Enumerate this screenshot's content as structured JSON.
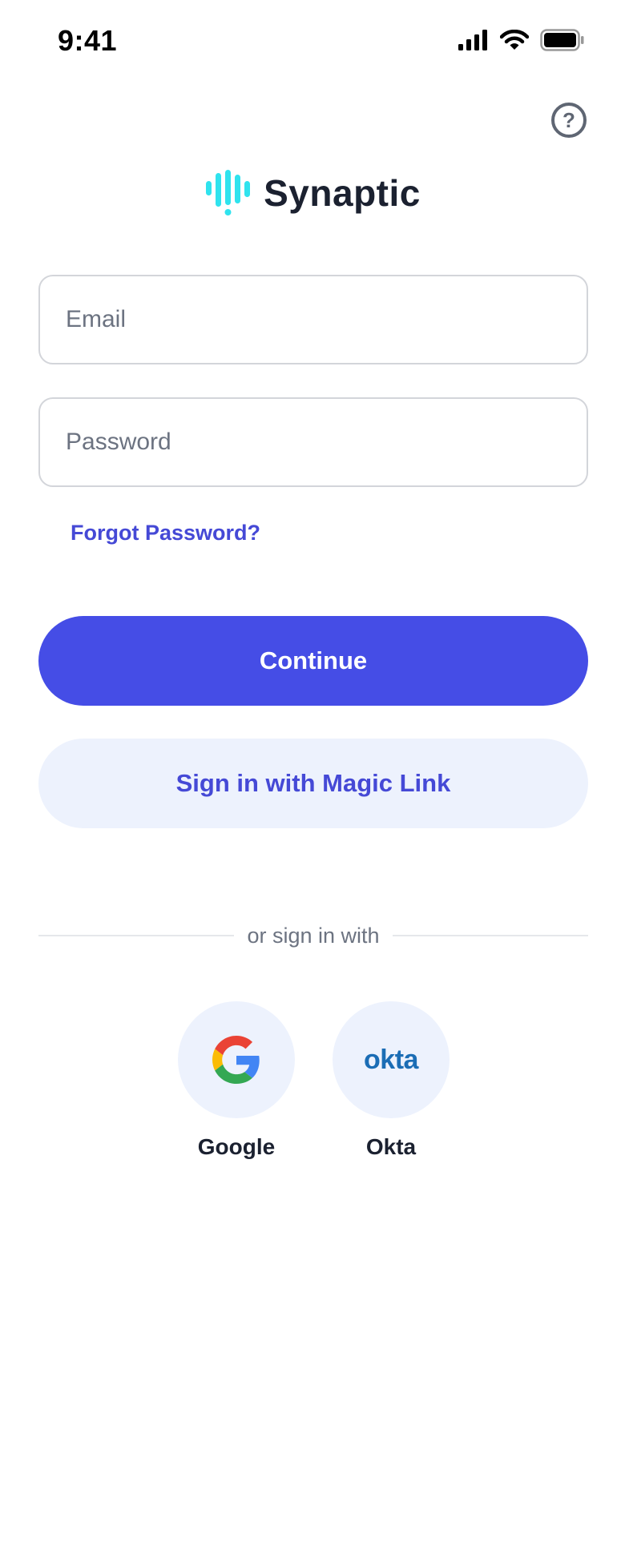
{
  "status_bar": {
    "time": "9:41"
  },
  "app": {
    "name": "Synaptic",
    "brand_color": "#2fe3ee"
  },
  "help": {
    "glyph": "?"
  },
  "form": {
    "email_placeholder": "Email",
    "email_value": "",
    "password_placeholder": "Password",
    "password_value": "",
    "forgot_password": "Forgot Password?"
  },
  "actions": {
    "continue_label": "Continue",
    "magic_link_label": "Sign in with Magic Link"
  },
  "divider": {
    "text": "or sign in with"
  },
  "providers": [
    {
      "label": "Google",
      "icon": "google-icon"
    },
    {
      "label": "Okta",
      "icon": "okta-icon",
      "mark": "okta"
    }
  ],
  "colors": {
    "primary": "#454de6",
    "secondary_bg": "#edf2fd",
    "link": "#4549d6"
  }
}
